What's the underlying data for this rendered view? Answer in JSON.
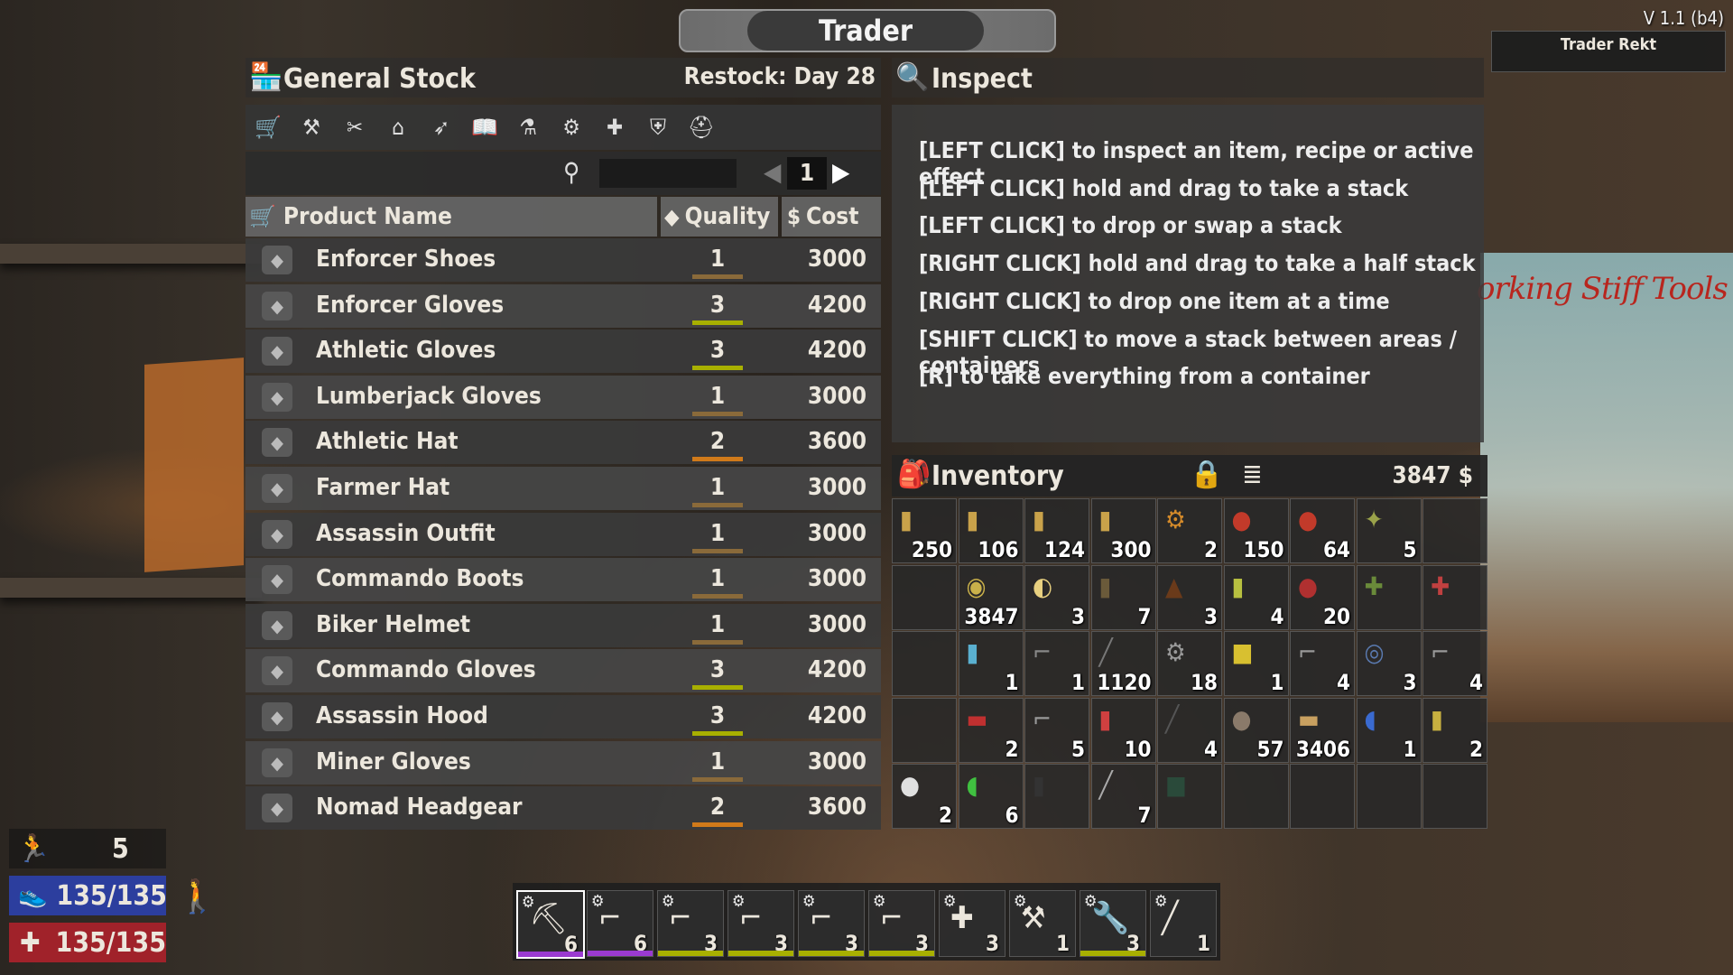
{
  "window_title": "Trader",
  "version": "V 1.1 (b4)",
  "trader_name": "Trader Rekt",
  "general_stock": {
    "title": "General Stock",
    "restock": "Restock: Day 28",
    "page": "1",
    "columns": {
      "name": "Product Name",
      "quality": "Quality",
      "cost": "Cost"
    },
    "categories": [
      "cart-icon",
      "tools-icon",
      "weapons-icon",
      "building-icon",
      "ammo-icon",
      "books-icon",
      "chemistry-icon",
      "parts-icon",
      "medical-icon",
      "armor-icon",
      "clothing-icon"
    ],
    "items": [
      {
        "name": "Enforcer Shoes",
        "quality": "1",
        "cost": "3000",
        "color": "#8a6a3a"
      },
      {
        "name": "Enforcer Gloves",
        "quality": "3",
        "cost": "4200",
        "color": "#a8b000"
      },
      {
        "name": "Athletic Gloves",
        "quality": "3",
        "cost": "4200",
        "color": "#a8b000"
      },
      {
        "name": "Lumberjack Gloves",
        "quality": "1",
        "cost": "3000",
        "color": "#8a6a3a"
      },
      {
        "name": "Athletic Hat",
        "quality": "2",
        "cost": "3600",
        "color": "#d07a1a"
      },
      {
        "name": "Farmer Hat",
        "quality": "1",
        "cost": "3000",
        "color": "#8a6a3a"
      },
      {
        "name": "Assassin Outfit",
        "quality": "1",
        "cost": "3000",
        "color": "#8a6a3a"
      },
      {
        "name": "Commando Boots",
        "quality": "1",
        "cost": "3000",
        "color": "#8a6a3a"
      },
      {
        "name": "Biker Helmet",
        "quality": "1",
        "cost": "3000",
        "color": "#8a6a3a"
      },
      {
        "name": "Commando Gloves",
        "quality": "3",
        "cost": "4200",
        "color": "#a8b000"
      },
      {
        "name": "Assassin Hood",
        "quality": "3",
        "cost": "4200",
        "color": "#a8b000"
      },
      {
        "name": "Miner Gloves",
        "quality": "1",
        "cost": "3000",
        "color": "#8a6a3a"
      },
      {
        "name": "Nomad Headgear",
        "quality": "2",
        "cost": "3600",
        "color": "#d07a1a"
      }
    ]
  },
  "inspect": {
    "title": "Inspect",
    "lines": [
      "[LEFT CLICK] to inspect an item, recipe or active effect",
      "[LEFT CLICK] hold and drag to take a stack",
      "[LEFT CLICK] to drop or swap a stack",
      "[RIGHT CLICK] hold and drag to take a half stack",
      "[RIGHT CLICK] to drop one item at a time",
      "[SHIFT CLICK] to move a stack between areas / containers",
      "[R] to take everything from a container"
    ]
  },
  "inventory": {
    "title": "Inventory",
    "coins": "3847",
    "slots": [
      {
        "icon": "bullet-icon",
        "glyph": "▮",
        "count": "250",
        "color": "#c9a24a"
      },
      {
        "icon": "bullet-icon",
        "glyph": "▮",
        "count": "106",
        "color": "#c9a24a"
      },
      {
        "icon": "bullet-icon",
        "glyph": "▮",
        "count": "124",
        "color": "#c9a24a"
      },
      {
        "icon": "bullet-icon",
        "glyph": "▮",
        "count": "300",
        "color": "#c9a24a"
      },
      {
        "icon": "turret-icon",
        "glyph": "⚙",
        "count": "2",
        "color": "#d48a2a"
      },
      {
        "icon": "shotgun-shell-icon",
        "glyph": "●",
        "count": "150",
        "color": "#c23a2a"
      },
      {
        "icon": "shotgun-shell-icon",
        "glyph": "●",
        "count": "64",
        "color": "#c23a2a"
      },
      {
        "icon": "drone-icon",
        "glyph": "✦",
        "count": "5",
        "color": "#9aa24a"
      },
      {
        "icon": "empty-slot",
        "glyph": "",
        "count": "",
        "color": "#555"
      },
      {
        "icon": "empty-slot",
        "glyph": "",
        "count": "",
        "color": "#555"
      },
      {
        "icon": "dukes-coin-icon",
        "glyph": "◉",
        "count": "3847",
        "color": "#c9b04a"
      },
      {
        "icon": "bacon-eggs-icon",
        "glyph": "◐",
        "count": "3",
        "color": "#e8d080"
      },
      {
        "icon": "coffee-can-icon",
        "glyph": "▮",
        "count": "7",
        "color": "#6a5a3a"
      },
      {
        "icon": "coffee-beans-icon",
        "glyph": "▲",
        "count": "3",
        "color": "#6a3a1a"
      },
      {
        "icon": "can-icon",
        "glyph": "▮",
        "count": "4",
        "color": "#b8c040"
      },
      {
        "icon": "meat-icon",
        "glyph": "●",
        "count": "20",
        "color": "#b03030"
      },
      {
        "icon": "armor-mod-icon",
        "glyph": "✚",
        "count": "",
        "color": "#6a8a3a"
      },
      {
        "icon": "weapon-mod-icon",
        "glyph": "✚",
        "count": "",
        "color": "#c04040"
      },
      {
        "icon": "empty-slot",
        "glyph": "",
        "count": "",
        "color": "#555"
      },
      {
        "icon": "cleaning-bottle-icon",
        "glyph": "▮",
        "count": "1",
        "color": "#5ab0d0"
      },
      {
        "icon": "pistol-parts-icon",
        "glyph": "⌐",
        "count": "1",
        "color": "#888"
      },
      {
        "icon": "nails-icon",
        "glyph": "╱",
        "count": "1120",
        "color": "#777"
      },
      {
        "icon": "mechanical-parts-icon",
        "glyph": "⚙",
        "count": "18",
        "color": "#999"
      },
      {
        "icon": "book-icon",
        "glyph": "■",
        "count": "1",
        "color": "#d8c030"
      },
      {
        "icon": "gun-parts-icon",
        "glyph": "⌐",
        "count": "4",
        "color": "#999"
      },
      {
        "icon": "motor-icon",
        "glyph": "◎",
        "count": "3",
        "color": "#5a7ab0"
      },
      {
        "icon": "rifle-parts-icon",
        "glyph": "⌐",
        "count": "4",
        "color": "#999"
      },
      {
        "icon": "empty-slot",
        "glyph": "",
        "count": "",
        "color": "#555"
      },
      {
        "icon": "toolbox-icon",
        "glyph": "▬",
        "count": "2",
        "color": "#c03030"
      },
      {
        "icon": "shotgun-parts-icon",
        "glyph": "⌐",
        "count": "5",
        "color": "#999"
      },
      {
        "icon": "spray-can-icon",
        "glyph": "▮",
        "count": "10",
        "color": "#d04040"
      },
      {
        "icon": "pipe-icon",
        "glyph": "╱",
        "count": "4",
        "color": "#555"
      },
      {
        "icon": "stone-icon",
        "glyph": "●",
        "count": "57",
        "color": "#8a7a6a"
      },
      {
        "icon": "wood-icon",
        "glyph": "▬",
        "count": "3406",
        "color": "#c8a060"
      },
      {
        "icon": "pill-icon",
        "glyph": "◖",
        "count": "1",
        "color": "#3a6ad0"
      },
      {
        "icon": "jar-icon",
        "glyph": "▮",
        "count": "2",
        "color": "#c8b040"
      },
      {
        "icon": "painkiller-icon",
        "glyph": "●",
        "count": "2",
        "color": "#e0e0e0"
      },
      {
        "icon": "vitamins-icon",
        "glyph": "◖",
        "count": "6",
        "color": "#40c040"
      },
      {
        "icon": "radio-icon",
        "glyph": "▮",
        "count": "",
        "color": "#333"
      },
      {
        "icon": "lockpick-icon",
        "glyph": "╱",
        "count": "7",
        "color": "#aaa"
      },
      {
        "icon": "first-aid-kit-icon",
        "glyph": "■",
        "count": "",
        "color": "#2a4a3a"
      },
      {
        "icon": "empty-slot",
        "glyph": "",
        "count": "",
        "color": "#555"
      },
      {
        "icon": "empty-slot",
        "glyph": "",
        "count": "",
        "color": "#555"
      },
      {
        "icon": "empty-slot",
        "glyph": "",
        "count": "",
        "color": "#555"
      },
      {
        "icon": "empty-slot",
        "glyph": "",
        "count": "",
        "color": "#555"
      }
    ]
  },
  "stats": {
    "level": "5",
    "stamina": "135/135",
    "health": "135/135"
  },
  "toolbelt": [
    {
      "icon": "pickaxe-icon",
      "glyph": "⛏",
      "count": "6",
      "bar": "#9a3ad0",
      "selected": true
    },
    {
      "icon": "rifle-icon",
      "glyph": "⌐",
      "count": "6",
      "bar": "#9a3ad0",
      "selected": false
    },
    {
      "icon": "sniper-icon",
      "glyph": "⌐",
      "count": "3",
      "bar": "#a8b000",
      "selected": false
    },
    {
      "icon": "smg-icon",
      "glyph": "⌐",
      "count": "3",
      "bar": "#a8b000",
      "selected": false
    },
    {
      "icon": "shotgun-icon",
      "glyph": "⌐",
      "count": "3",
      "bar": "#a8b000",
      "selected": false
    },
    {
      "icon": "hunting-rifle-icon",
      "glyph": "⌐",
      "count": "3",
      "bar": "#a8b000",
      "selected": false
    },
    {
      "icon": "medkit-icon",
      "glyph": "✚",
      "count": "3",
      "bar": "",
      "selected": false
    },
    {
      "icon": "sledgehammer-icon",
      "glyph": "⚒",
      "count": "1",
      "bar": "",
      "selected": false
    },
    {
      "icon": "wrench-icon",
      "glyph": "🔧",
      "count": "3",
      "bar": "#a8b000",
      "selected": false
    },
    {
      "icon": "knife-icon",
      "glyph": "╱",
      "count": "1",
      "bar": "",
      "selected": false
    }
  ]
}
